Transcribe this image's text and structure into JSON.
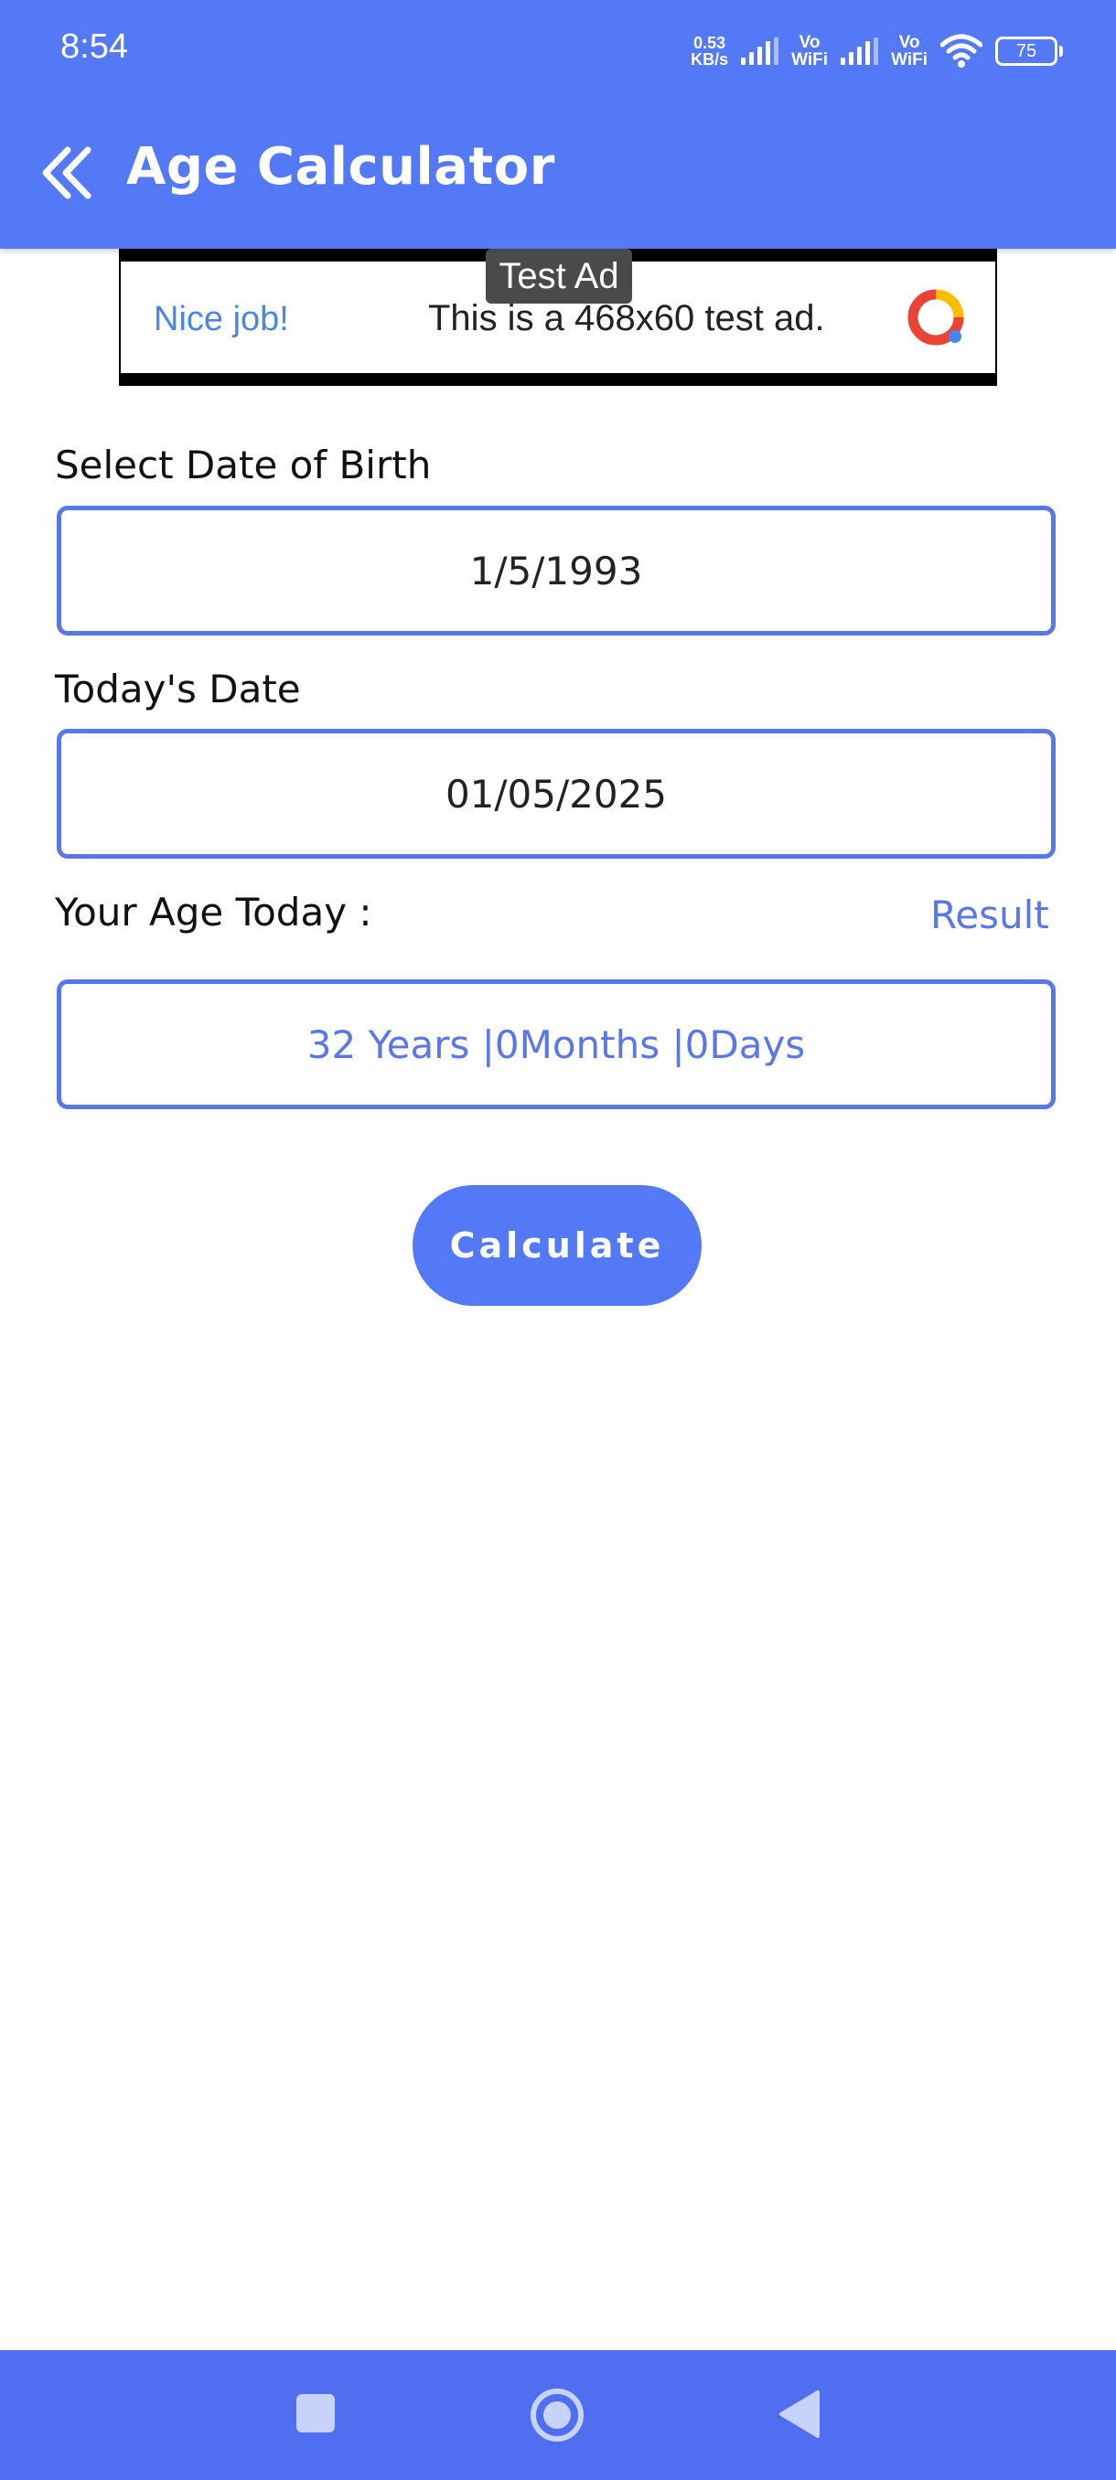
{
  "status_bar": {
    "time": "8:54",
    "net_speed_value": "0.53",
    "net_speed_unit": "KB/s",
    "vowifi_top": "Vo",
    "vowifi_bottom": "WiFi",
    "battery": "75"
  },
  "app_bar": {
    "title": "Age Calculator",
    "back_icon": "double-chevron-left-icon"
  },
  "ad": {
    "tag": "Test Ad",
    "headline": "Nice job!",
    "body": "This is a 468x60 test ad."
  },
  "form": {
    "dob_label": "Select Date of Birth",
    "dob_value": "1/5/1993",
    "today_label": "Today's Date",
    "today_value": "01/05/2025",
    "age_label": "Your Age Today :",
    "result_label": "Result",
    "result_value": "32 Years |0Months |0Days",
    "calculate_label": "Calculate"
  },
  "colors": {
    "primary": "#5379f6",
    "field_border": "#5a77e8",
    "ad_link": "#4a86e8"
  },
  "nav": {
    "icons": [
      "recent-apps-icon",
      "home-icon",
      "back-icon"
    ]
  }
}
